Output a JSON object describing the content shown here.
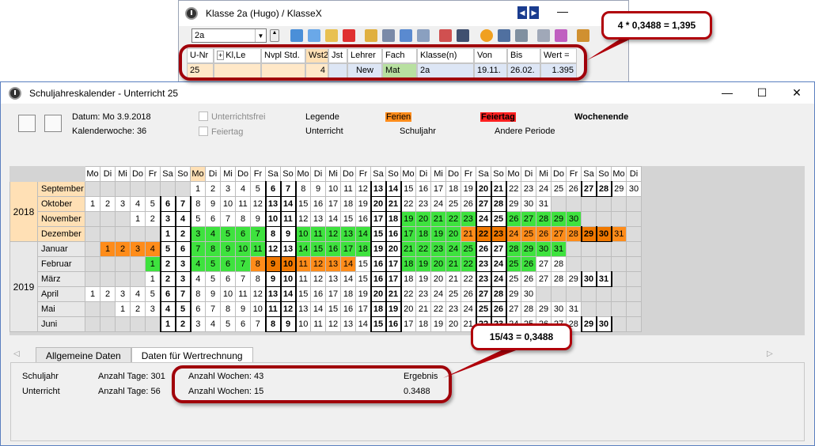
{
  "back_window": {
    "title": "Klasse 2a (Hugo) / KlasseX",
    "combo_value": "2a",
    "columns": [
      "U-Nr",
      "Kl,Le",
      "Nvpl Std.",
      "Wst2",
      "Jst",
      "Lehrer",
      "Fach",
      "Klasse(n)",
      "Von",
      "Bis",
      "Wert ="
    ],
    "row": [
      "25",
      "",
      "",
      "4",
      "",
      "New",
      "Mat",
      "2a",
      "19.11.",
      "26.02.",
      "1.395"
    ]
  },
  "front_window": {
    "title": "Schuljahreskalender - Unterricht 25",
    "datum": "Datum: Mo 3.9.2018",
    "kalenderwoche": "Kalenderwoche: 36",
    "unterrichtsfrei": "Unterrichtsfrei",
    "feiertag_chk": "Feiertag",
    "legende": "Legende",
    "ferien": "Ferien",
    "feiertag": "Feiertag",
    "wochenende": "Wochenende",
    "unterricht": "Unterricht",
    "schuljahr": "Schuljahr",
    "andere_periode": "Andere Periode"
  },
  "calendar": {
    "weekdays": [
      "Mo",
      "Di",
      "Mi",
      "Do",
      "Fr",
      "Sa",
      "So"
    ],
    "years": [
      "2018",
      "2019"
    ],
    "months": [
      {
        "name": "September",
        "start": 7,
        "days": 30,
        "year": 0
      },
      {
        "name": "Oktober",
        "start": 0,
        "days": 31,
        "year": 0
      },
      {
        "name": "November",
        "start": 3,
        "days": 30,
        "year": 0
      },
      {
        "name": "Dezember",
        "start": 5,
        "days": 31,
        "year": 0
      },
      {
        "name": "Januar",
        "start": 1,
        "days": 31,
        "year": 1
      },
      {
        "name": "Februar",
        "start": 4,
        "days": 28,
        "year": 1
      },
      {
        "name": "März",
        "start": 4,
        "days": 31,
        "year": 1
      },
      {
        "name": "April",
        "start": 0,
        "days": 30,
        "year": 1
      },
      {
        "name": "Mai",
        "start": 2,
        "days": 31,
        "year": 1
      },
      {
        "name": "Juni",
        "start": 5,
        "days": 30,
        "year": 1
      }
    ],
    "unterricht_days": {
      "November": [
        19,
        20,
        21,
        22,
        23,
        26,
        27,
        28,
        29,
        30
      ],
      "Dezember": [
        3,
        4,
        5,
        6,
        7,
        10,
        11,
        12,
        13,
        14,
        17,
        18,
        19,
        20
      ],
      "Januar": [
        7,
        8,
        9,
        10,
        11,
        14,
        15,
        16,
        17,
        18,
        21,
        22,
        23,
        24,
        25,
        28,
        29,
        30,
        31
      ],
      "Februar": [
        1,
        4,
        5,
        6,
        7,
        18,
        19,
        20,
        21,
        22,
        25,
        26
      ]
    },
    "ferien_days": {
      "Dezember": [
        21,
        22,
        23,
        24,
        25,
        26,
        27,
        28,
        29,
        30,
        31
      ],
      "Januar": [
        1,
        2,
        3,
        4
      ],
      "Februar": [
        8,
        9,
        10,
        11,
        12,
        13,
        14
      ]
    }
  },
  "tabs": [
    "Allgemeine Daten",
    "Daten für Wertrechnung"
  ],
  "summary": {
    "schuljahr_label": "Schuljahr",
    "unterricht_label": "Unterricht",
    "tage_schuljahr": "Anzahl Tage: 301",
    "tage_unterricht": "Anzahl Tage: 56",
    "wochen_schuljahr": "Anzahl Wochen: 43",
    "wochen_unterricht": "Anzahl Wochen: 15",
    "ergebnis_label": "Ergebnis",
    "ergebnis_value": "0.3488"
  },
  "callouts": {
    "top": "4 * 0,3488 = 1,395",
    "middle": "15/43 = 0,3488"
  },
  "colors": {
    "unterricht": "#3ee23e",
    "ferien": "#ff8c1a",
    "feiertag": "#ff2020",
    "callout_border": "#b0000a"
  }
}
